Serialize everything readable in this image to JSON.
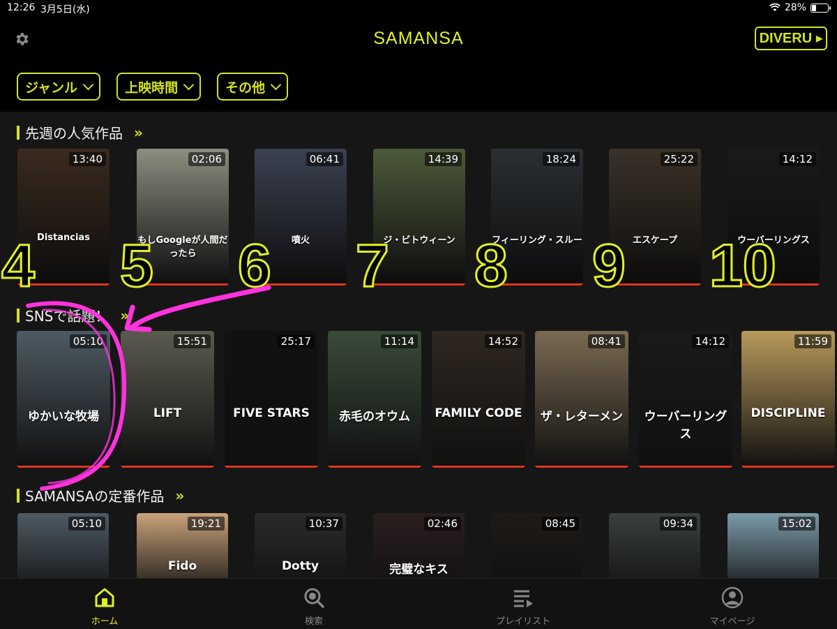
{
  "status_bar": {
    "time": "12:26",
    "date": "3月5日(水)",
    "battery": "28%",
    "battery_level": 0.28
  },
  "header": {
    "title": "SAMANSA",
    "diveru_label": "DIVERU",
    "filters": [
      {
        "label": "ジャンル"
      },
      {
        "label": "上映時間"
      },
      {
        "label": "その他"
      }
    ]
  },
  "sections": [
    {
      "title": "先週の人気作品",
      "more": "»",
      "items": [
        {
          "rank": "4",
          "duration": "13:40",
          "poster_text": "Distancias",
          "bg": "#3a2a1e"
        },
        {
          "rank": "5",
          "duration": "02:06",
          "poster_text": "もしGoogleが人間だったら",
          "bg": "#8a8f80"
        },
        {
          "rank": "6",
          "duration": "06:41",
          "poster_text": "噴火",
          "bg": "#3b4150"
        },
        {
          "rank": "7",
          "duration": "14:39",
          "poster_text": "ジ・ビトウィーン",
          "bg": "#4d5a3a"
        },
        {
          "rank": "8",
          "duration": "18:24",
          "poster_text": "フィーリング・スルー",
          "bg": "#2a2f33"
        },
        {
          "rank": "9",
          "duration": "25:22",
          "poster_text": "エスケープ",
          "bg": "#3a3128"
        },
        {
          "rank": "10",
          "duration": "14:12",
          "poster_text": "ウーバーリングス",
          "bg": "#1a1a1a"
        }
      ]
    },
    {
      "title": "SNSで話題！",
      "more": "»",
      "items": [
        {
          "duration": "05:10",
          "poster_text": "ゆかいな牧場",
          "bg": "#4e5a63"
        },
        {
          "duration": "15:51",
          "poster_text": "LIFT",
          "bg": "#5a5a50"
        },
        {
          "duration": "25:17",
          "poster_text": "FIVE STARS",
          "bg": "#111111"
        },
        {
          "duration": "11:14",
          "poster_text": "赤毛のオウム",
          "bg": "#3a4a3a"
        },
        {
          "duration": "14:52",
          "poster_text": "FAMILY CODE",
          "bg": "#2f2720"
        },
        {
          "duration": "08:41",
          "poster_text": "ザ・レターメン",
          "bg": "#7a6a52"
        },
        {
          "duration": "14:12",
          "poster_text": "ウーバーリングス",
          "bg": "#1a1a1a"
        },
        {
          "duration": "11:59",
          "poster_text": "DISCIPLINE",
          "bg": "#b89a5a"
        }
      ]
    },
    {
      "title": "SAMANSAの定番作品",
      "more": "»",
      "items": [
        {
          "duration": "05:10",
          "poster_text": "",
          "bg": "#4e5a63"
        },
        {
          "duration": "19:21",
          "poster_text": "Fido",
          "bg": "#c9a27a"
        },
        {
          "duration": "10:37",
          "poster_text": "Dotty",
          "bg": "#2a2a2a"
        },
        {
          "duration": "02:46",
          "poster_text": "完璧なキス",
          "bg": "#2a1f1f"
        },
        {
          "duration": "08:45",
          "poster_text": "",
          "bg": "#1e1a17"
        },
        {
          "duration": "09:34",
          "poster_text": "",
          "bg": "#3a3f3f"
        },
        {
          "duration": "15:02",
          "poster_text": "",
          "bg": "#7b9aa8"
        }
      ]
    }
  ],
  "tabs": [
    {
      "label": "ホーム",
      "icon": "home-icon",
      "active": true
    },
    {
      "label": "検索",
      "icon": "search-icon",
      "active": false
    },
    {
      "label": "プレイリスト",
      "icon": "playlist-icon",
      "active": false
    },
    {
      "label": "マイページ",
      "icon": "profile-icon",
      "active": false
    }
  ],
  "colors": {
    "accent": "#e2ef22",
    "background": "#000000",
    "content_bg": "#161616",
    "annotation": "#ff33dd",
    "progress_red": "#e0351e"
  }
}
